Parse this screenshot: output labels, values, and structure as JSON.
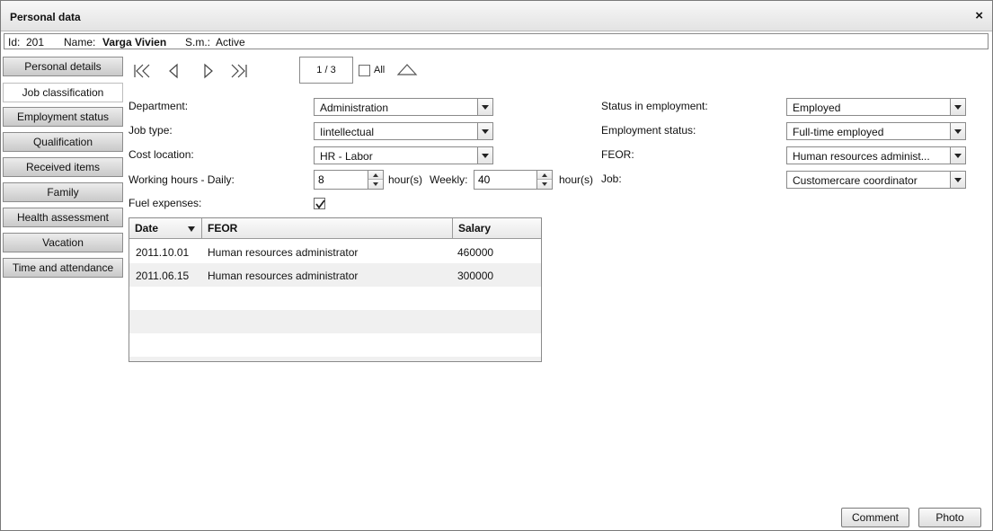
{
  "window": {
    "title": "Personal data",
    "close_symbol": "×"
  },
  "info": {
    "id_label": "Id:",
    "id_value": "201",
    "name_label": "Name:",
    "name_value": "Varga Vivien",
    "status_label": "S.m.:",
    "status_value": "Active"
  },
  "tabs": [
    {
      "label": "Personal details"
    },
    {
      "label": "Job classification",
      "active": true
    },
    {
      "label": "Employment status"
    },
    {
      "label": "Qualification"
    },
    {
      "label": "Received items"
    },
    {
      "label": "Family"
    },
    {
      "label": "Health assessment"
    },
    {
      "label": "Vacation"
    },
    {
      "label": "Time and attendance"
    }
  ],
  "pager": {
    "position": "1 / 3",
    "all_label": "All"
  },
  "form": {
    "department": {
      "label": "Department:",
      "value": "Administration"
    },
    "job_type": {
      "label": "Job type:",
      "value": "Iintellectual"
    },
    "cost_location": {
      "label": "Cost location:",
      "value": "HR - Labor"
    },
    "working_hours": {
      "label": "Working hours - Daily:",
      "daily": "8",
      "unit": "hour(s)",
      "weekly_label": "Weekly:",
      "weekly": "40"
    },
    "fuel_expenses": {
      "label": "Fuel expenses:",
      "checked": true
    },
    "status_in_employment": {
      "label": "Status in employment:",
      "value": "Employed"
    },
    "employment_status": {
      "label": "Employment status:",
      "value": "Full-time employed"
    },
    "feor": {
      "label": "FEOR:",
      "value": "Human resources administ..."
    },
    "job": {
      "label": "Job:",
      "value": "Customercare coordinator"
    }
  },
  "table": {
    "columns": [
      "Date",
      "FEOR",
      "Salary"
    ],
    "rows": [
      {
        "date": "2011.10.01",
        "feor": "Human resources administrator",
        "salary": "460000"
      },
      {
        "date": "2011.06.15",
        "feor": "Human resources administrator",
        "salary": "300000"
      }
    ]
  },
  "buttons": {
    "comment": "Comment",
    "photo": "Photo"
  },
  "icons": {
    "first": "first-page-icon",
    "prev": "previous-page-icon",
    "next": "next-page-icon",
    "last": "last-page-icon",
    "up": "collapse-up-icon",
    "sort": "sort-descending-icon",
    "check": "checkmark-icon"
  }
}
